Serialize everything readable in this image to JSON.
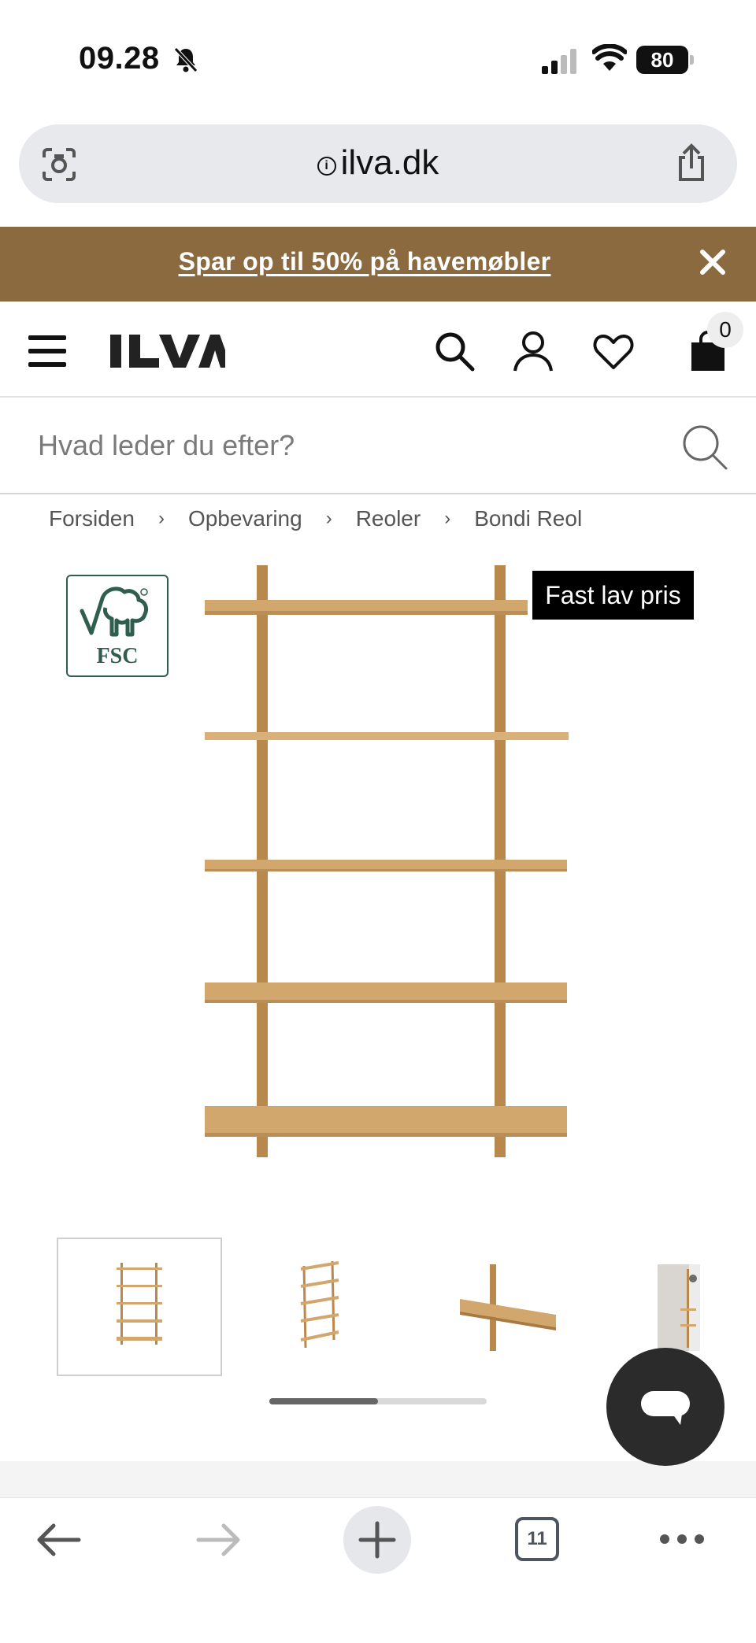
{
  "status_bar": {
    "time": "09.28",
    "battery": "80"
  },
  "browser": {
    "url": "ilva.dk",
    "tab_count": "11"
  },
  "promo": {
    "text": "Spar op til 50% på havemøbler"
  },
  "header": {
    "logo": "ILVA",
    "cart_count": "0"
  },
  "search": {
    "placeholder": "Hvad leder du efter?"
  },
  "breadcrumb": [
    "Forsiden",
    "Opbevaring",
    "Reoler",
    "Bondi Reol"
  ],
  "product": {
    "price_badge": "Fast lav pris",
    "certification": "FSC",
    "gallery": {
      "image_count": 4,
      "active_index": 0
    }
  },
  "colors": {
    "promo_bg": "#8b6a3f",
    "wood": "#d2a76e",
    "wood_dark": "#b9884c",
    "fsc_green": "#2f5e4e"
  },
  "icons": [
    "camera-search-icon",
    "info-icon",
    "share-icon",
    "close-icon",
    "hamburger-icon",
    "search-icon",
    "user-icon",
    "heart-icon",
    "bag-icon",
    "chat-icon",
    "back-arrow-icon",
    "forward-arrow-icon",
    "plus-icon",
    "tabs-icon",
    "more-icon"
  ]
}
